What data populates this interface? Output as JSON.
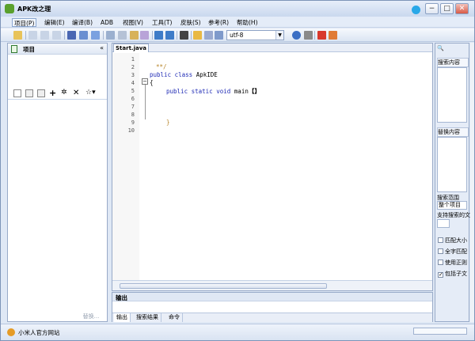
{
  "window": {
    "title": "APK改之理",
    "buttons": [
      "−",
      "□",
      "✕"
    ]
  },
  "menu": [
    {
      "label": "项目(P)",
      "active": true
    },
    {
      "label": "编辑(E)"
    },
    {
      "label": "编译(B)"
    },
    {
      "label": "ADB"
    },
    {
      "label": "视图(V)"
    },
    {
      "label": "工具(T)"
    },
    {
      "label": "皮肤(S)"
    },
    {
      "label": "参考(R)"
    },
    {
      "label": "帮助(H)"
    }
  ],
  "toolbar": {
    "encoding": "utf-8",
    "icons": [
      "new-project-icon",
      "open-icon",
      "save-all-icon",
      "copy-icon",
      "save-icon",
      "cut-icon",
      "paste-icon",
      "undo-icon",
      "redo-icon",
      "find-icon",
      "build-icon",
      "device-icon",
      "help-icon",
      "exit-icon",
      "home-icon"
    ]
  },
  "left_panel": {
    "title": "项目",
    "collapse": "«",
    "replace_button": "替换..."
  },
  "editor": {
    "tab": "Start.java",
    "lines": [
      "1",
      "2",
      "3",
      "4",
      "5",
      "6",
      "7",
      "8",
      "9",
      "10"
    ],
    "code": {
      "l2": "**/",
      "l3_kw": "public class",
      "l3_name": "ApkIDE",
      "l4": "{",
      "l5_kw": "public static void",
      "l5_name": "main",
      "l5_bracket": "【】",
      "l9": "}"
    }
  },
  "output": {
    "title": "输出",
    "tabs": [
      "输出",
      "搜索结果",
      "命令"
    ]
  },
  "right_panel": {
    "search_title": "搜索内容",
    "replace_title": "替换内容",
    "scope_label": "搜索范围",
    "scope_value": "整个项目",
    "ext_label": "支持搜索的文",
    "options": [
      "匹配大小",
      "全字匹配",
      "使用正则",
      "包括子文"
    ],
    "option_4_checked": true
  },
  "status": {
    "text": "小米人官方网站"
  }
}
